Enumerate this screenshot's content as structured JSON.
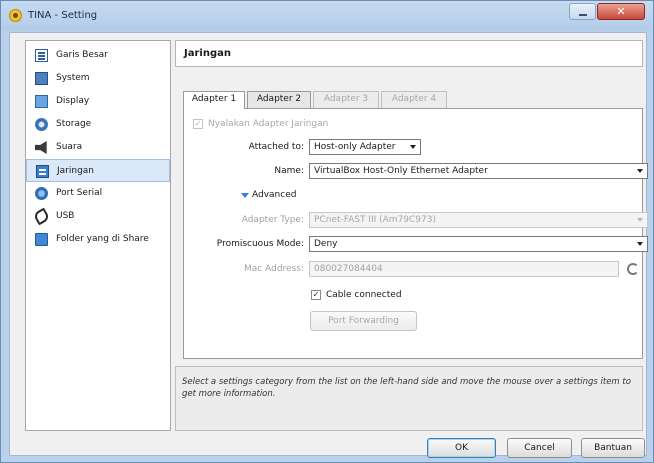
{
  "window": {
    "title": "TINA - Setting",
    "close_glyph": "✕"
  },
  "sidebar": {
    "items": [
      {
        "label": "Garis Besar",
        "icon": "general-icon"
      },
      {
        "label": "System",
        "icon": "system-icon"
      },
      {
        "label": "Display",
        "icon": "display-icon"
      },
      {
        "label": "Storage",
        "icon": "storage-icon"
      },
      {
        "label": "Suara",
        "icon": "audio-icon"
      },
      {
        "label": "Jaringan",
        "icon": "network-icon",
        "selected": true
      },
      {
        "label": "Port Serial",
        "icon": "serial-port-icon"
      },
      {
        "label": "USB",
        "icon": "usb-icon"
      },
      {
        "label": "Folder yang di Share",
        "icon": "shared-folder-icon"
      }
    ]
  },
  "header": {
    "title": "Jaringan"
  },
  "tabs": [
    {
      "label": "Adapter 1",
      "active": true
    },
    {
      "label": "Adapter 2"
    },
    {
      "label": "Adapter 3",
      "disabled": true
    },
    {
      "label": "Adapter 4",
      "disabled": true
    }
  ],
  "adapter": {
    "enable_label": "Nyalakan Adapter Jaringan",
    "enable_checked": true,
    "attached_label": "Attached to:",
    "attached_value": "Host-only Adapter",
    "name_label": "Name:",
    "name_value": "VirtualBox Host-Only Ethernet Adapter",
    "advanced_label": "Advanced",
    "adapter_type_label": "Adapter Type:",
    "adapter_type_value": "PCnet-FAST III (Am79C973)",
    "promiscuous_label": "Promiscuous Mode:",
    "promiscuous_value": "Deny",
    "mac_label": "Mac Address:",
    "mac_value": "080027084404",
    "cable_label": "Cable connected",
    "cable_checked": true,
    "port_forwarding_label": "Port Forwarding"
  },
  "info": {
    "text": "Select a settings category from the list on the left-hand side and move the mouse over a settings item to get more information."
  },
  "buttons": {
    "ok": "OK",
    "cancel": "Cancel",
    "help": "Bantuan"
  }
}
